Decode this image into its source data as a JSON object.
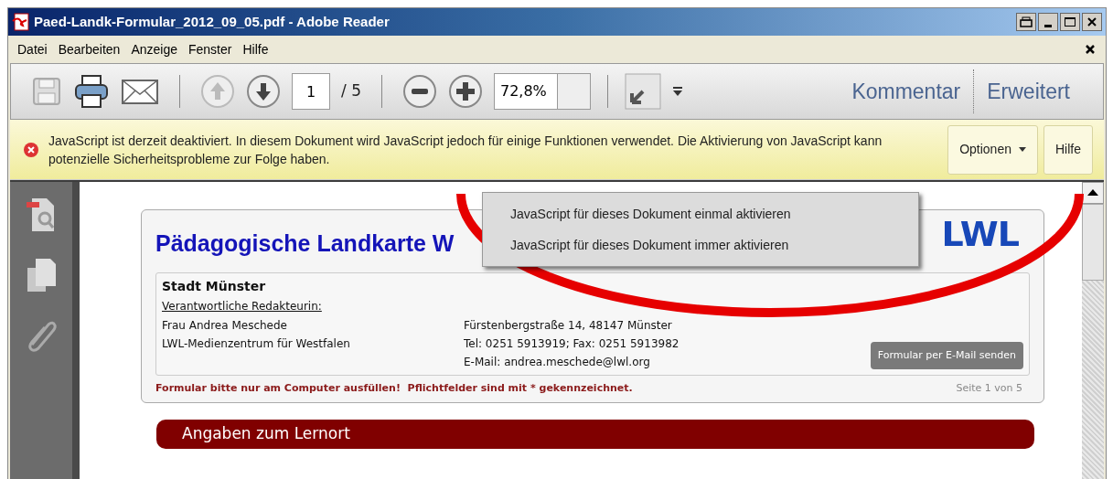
{
  "window": {
    "title": "Paed-Landk-Formular_2012_09_05.pdf - Adobe Reader"
  },
  "menu_bar": {
    "items": [
      "Datei",
      "Bearbeiten",
      "Anzeige",
      "Fenster",
      "Hilfe"
    ]
  },
  "toolbar": {
    "page_field": {
      "value": "1"
    },
    "page_total": "/ 5",
    "zoom_field": {
      "value": "72,8%"
    },
    "panes": [
      {
        "label": "Kommentar",
        "selected": false
      },
      {
        "label": "Erweitert",
        "selected": false
      }
    ]
  },
  "message_bar": {
    "text": "JavaScript ist derzeit deaktiviert. In diesem Dokument wird JavaScript jedoch für einige Funktionen verwendet. Die Aktivierung von JavaScript kann potenzielle Sicherheitsprobleme zur Folge haben.",
    "buttons": [
      {
        "label": "Optionen",
        "kind": "dropdown"
      },
      {
        "label": "Hilfe",
        "kind": "plain"
      }
    ]
  },
  "options_menu": {
    "items": [
      "JavaScript für dieses Dokument einmal aktivieren",
      "JavaScript für dieses Dokument immer aktivieren"
    ]
  },
  "document": {
    "title": "Pädagogische Landkarte W",
    "logo": "LWL",
    "city": "Stadt Münster",
    "editor_label": "Verantwortliche Redakteurin:",
    "contact_left": [
      "Frau Andrea Meschede",
      "LWL-Medienzentrum für Westfalen"
    ],
    "contact_right": [
      "Fürstenbergstraße 14, 48147 Münster",
      "Tel: 0251 5913919; Fax: 0251 5913982",
      "E-Mail: andrea.meschede@lwl.org"
    ],
    "email_button": "Formular per E-Mail senden",
    "notice": "Formular bitte nur am Computer ausfüllen!  Pflichtfelder sind mit * gekennzeichnet.",
    "page_indicator": "Seite 1 von 5",
    "section_bar": "Angaben zum Lernort"
  }
}
